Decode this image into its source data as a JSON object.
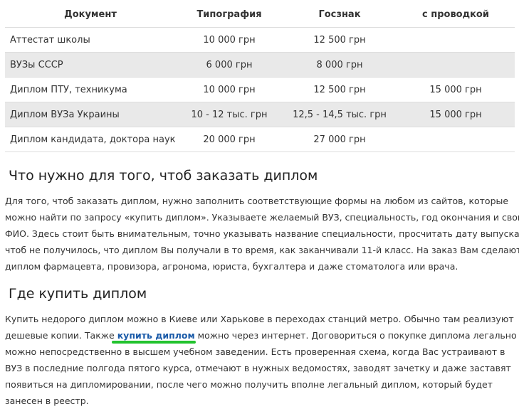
{
  "table": {
    "headers": [
      "Документ",
      "Типография",
      "Госзнак",
      "с проводкой"
    ],
    "rows": [
      [
        "Аттестат школы",
        "10 000 грн",
        "12 500 грн",
        ""
      ],
      [
        "ВУЗы СССР",
        "6 000 грн",
        "8 000 грн",
        ""
      ],
      [
        "Диплом ПТУ, техникума",
        "10 000 грн",
        "12 500 грн",
        "15 000 грн"
      ],
      [
        "Диплом ВУЗа Украины",
        "10 - 12 тыс. грн",
        "12,5 - 14,5 тыс. грн",
        "15 000 грн"
      ],
      [
        "Диплом кандидата, доктора наук",
        "20 000 грн",
        "27 000 грн",
        ""
      ]
    ]
  },
  "section_order": {
    "title": "Что нужно для того, чтоб заказать диплом",
    "lines": [
      " Для того, чтоб заказать диплом, нужно заполнить соответствующие формы на любом из сайтов, которые",
      "можно найти по запросу «купить диплом». Указываете желаемый ВУЗ, специальность, год окончания и свои",
      "ФИО. Здесь стоит быть внимательным, точно указывать название специальности, просчитать дату выпуска,",
      "чтоб не получилось, что диплом Вы получали в то время, как заканчивали 11-й класс. На заказ Вам сделают",
      "диплом фармацевта, провизора, агронома, юриста, бухгалтера и даже стоматолога или врача."
    ]
  },
  "section_buy": {
    "title": "Где купить диплом",
    "line1": " Купить недорого диплом можно в Киеве или Харькове в переходах станций метро. Обычно там реализуют",
    "line2_before": "дешевые копии. Также ",
    "line2_link": "купить диплом",
    "line2_after": " можно через интернет. Договориться о покупке диплома легально",
    "lines_rest": [
      "можно непосредственно в высшем учебном заведении. Есть проверенная схема, когда Вас устраивают в",
      "ВУЗ в последние полгода пятого курса, отмечают в нужных ведомостях, заводят зачетку и даже заставят",
      "появиться на дипломировании, после чего можно получить вполне легальный диплом, который будет",
      "занесен в реестр."
    ]
  },
  "colors": {
    "link": "#1a5aa8",
    "highlight_underline": "#22c32e",
    "row_alt_bg": "#e9e9e9"
  }
}
